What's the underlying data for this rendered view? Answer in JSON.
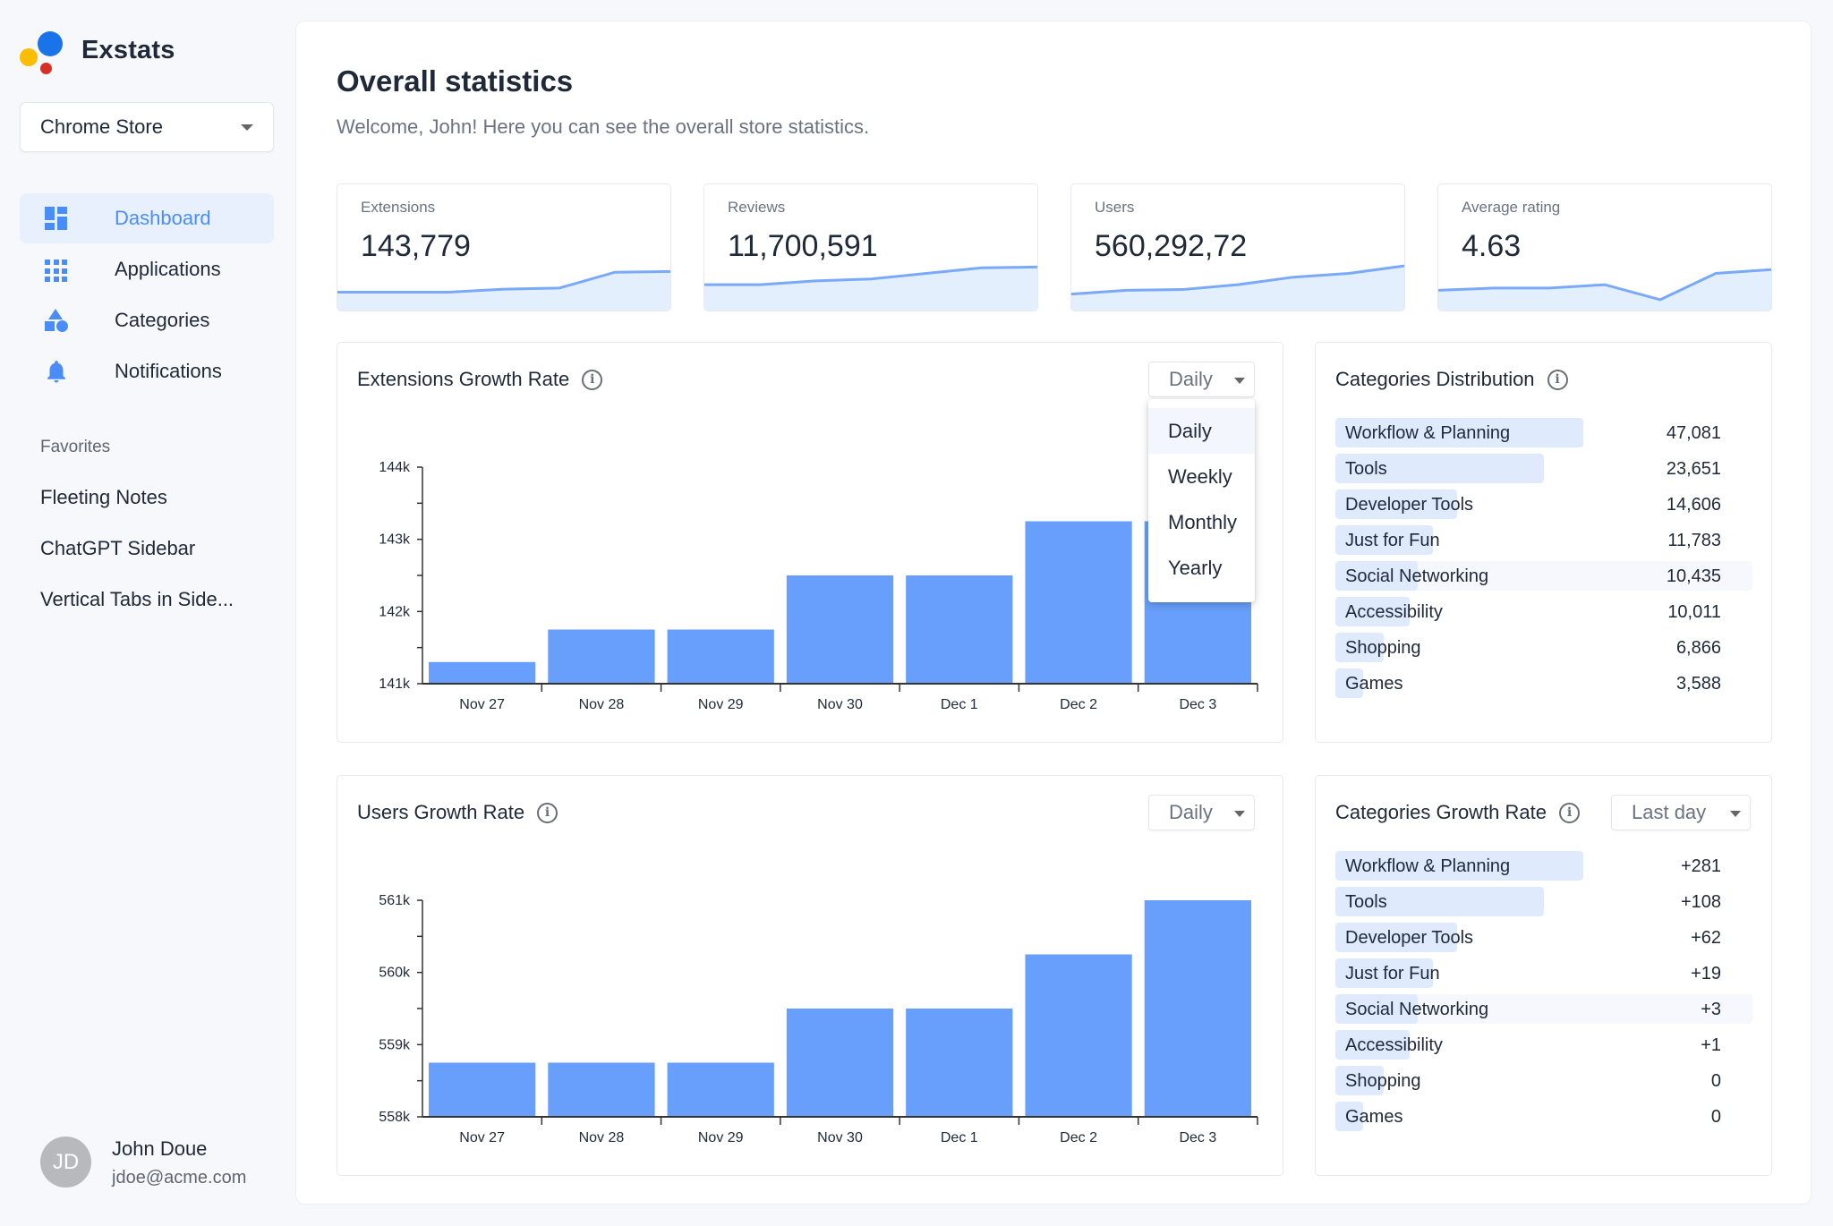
{
  "app": {
    "name": "Exstats",
    "logo_colors": {
      "blue": "#1a73e8",
      "yellow": "#fbbc04",
      "red": "#d93025"
    }
  },
  "sidebar": {
    "store_select": {
      "value": "Chrome Store"
    },
    "nav": [
      {
        "label": "Dashboard",
        "icon": "dashboard-icon",
        "active": true
      },
      {
        "label": "Applications",
        "icon": "apps-grid-icon",
        "active": false
      },
      {
        "label": "Categories",
        "icon": "shapes-icon",
        "active": false
      },
      {
        "label": "Notifications",
        "icon": "bell-icon",
        "active": false
      }
    ],
    "favorites_label": "Favorites",
    "favorites": [
      "Fleeting Notes",
      "ChatGPT Sidebar",
      "Vertical Tabs in Side..."
    ],
    "user": {
      "initials": "JD",
      "name": "John Doue",
      "email": "jdoe@acme.com"
    }
  },
  "header": {
    "title": "Overall statistics",
    "subtitle": "Welcome, John! Here you can see the overall store statistics."
  },
  "stats": [
    {
      "label": "Extensions",
      "value": "143,779",
      "trend": [
        0.25,
        0.25,
        0.25,
        0.33,
        0.36,
        0.78,
        0.8
      ]
    },
    {
      "label": "Reviews",
      "value": "11,700,591",
      "trend": [
        0.45,
        0.45,
        0.55,
        0.6,
        0.75,
        0.9,
        0.92
      ]
    },
    {
      "label": "Users",
      "value": "560,292,72",
      "trend": [
        0.2,
        0.3,
        0.32,
        0.45,
        0.65,
        0.75,
        0.95
      ]
    },
    {
      "label": "Average rating",
      "value": "4.63",
      "trend": [
        0.3,
        0.36,
        0.36,
        0.45,
        0.05,
        0.75,
        0.85
      ]
    }
  ],
  "accent": "#4b8df8",
  "bar_color": "#689ffc",
  "extensions_growth": {
    "title": "Extensions Growth Rate",
    "period_select": {
      "value": "Daily",
      "open": true,
      "options": [
        "Daily",
        "Weekly",
        "Monthly",
        "Yearly"
      ],
      "highlighted": "Daily"
    }
  },
  "users_growth": {
    "title": "Users Growth Rate",
    "period_select": {
      "value": "Daily"
    }
  },
  "categories_distribution": {
    "title": "Categories Distribution",
    "hover_row": 4,
    "rows": [
      {
        "name": "Workflow & Planning",
        "value": "47,081",
        "bar_fraction": 0.595
      },
      {
        "name": "Tools",
        "value": "23,651",
        "bar_fraction": 0.5
      },
      {
        "name": "Developer Tools",
        "value": "14,606",
        "bar_fraction": 0.292
      },
      {
        "name": "Just for Fun",
        "value": "11,783",
        "bar_fraction": 0.234
      },
      {
        "name": "Social Networking",
        "value": "10,435",
        "bar_fraction": 0.197
      },
      {
        "name": "Accessibility",
        "value": "10,011",
        "bar_fraction": 0.179
      },
      {
        "name": "Shopping",
        "value": "6,866",
        "bar_fraction": 0.115
      },
      {
        "name": "Games",
        "value": "3,588",
        "bar_fraction": 0.066
      }
    ]
  },
  "categories_growth": {
    "title": "Categories Growth Rate",
    "period_select": {
      "value": "Last day"
    },
    "hover_row": 4,
    "rows": [
      {
        "name": "Workflow & Planning",
        "value": "+281",
        "bar_fraction": 0.595
      },
      {
        "name": "Tools",
        "value": "+108",
        "bar_fraction": 0.5
      },
      {
        "name": "Developer Tools",
        "value": "+62",
        "bar_fraction": 0.292
      },
      {
        "name": "Just for Fun",
        "value": "+19",
        "bar_fraction": 0.234
      },
      {
        "name": "Social Networking",
        "value": "+3",
        "bar_fraction": 0.197
      },
      {
        "name": "Accessibility",
        "value": "+1",
        "bar_fraction": 0.179
      },
      {
        "name": "Shopping",
        "value": "0",
        "bar_fraction": 0.115
      },
      {
        "name": "Games",
        "value": "0",
        "bar_fraction": 0.066
      }
    ]
  },
  "chart_data": [
    {
      "type": "bar",
      "title": "Extensions Growth Rate",
      "categories": [
        "Nov 27",
        "Nov 28",
        "Nov 29",
        "Nov 30",
        "Dec 1",
        "Dec 2",
        "Dec 3"
      ],
      "values": [
        141300,
        141750,
        141750,
        142500,
        142500,
        143250,
        143250
      ],
      "ylim": [
        141000,
        144000
      ],
      "yticks": [
        141000,
        142000,
        143000,
        144000
      ],
      "ytick_labels": [
        "141k",
        "142k",
        "143k",
        "144k"
      ],
      "minor_ticks": true,
      "xlabel": "",
      "ylabel": "",
      "grid": false
    },
    {
      "type": "bar",
      "title": "Users Growth Rate",
      "categories": [
        "Nov 27",
        "Nov 28",
        "Nov 29",
        "Nov 30",
        "Dec 1",
        "Dec 2",
        "Dec 3"
      ],
      "values": [
        558750,
        558750,
        558750,
        559500,
        559500,
        560250,
        561000
      ],
      "ylim": [
        558000,
        561000
      ],
      "yticks": [
        558000,
        559000,
        560000,
        561000
      ],
      "ytick_labels": [
        "558k",
        "559k",
        "560k",
        "561k"
      ],
      "minor_ticks": true,
      "xlabel": "",
      "ylabel": "",
      "grid": false
    }
  ]
}
